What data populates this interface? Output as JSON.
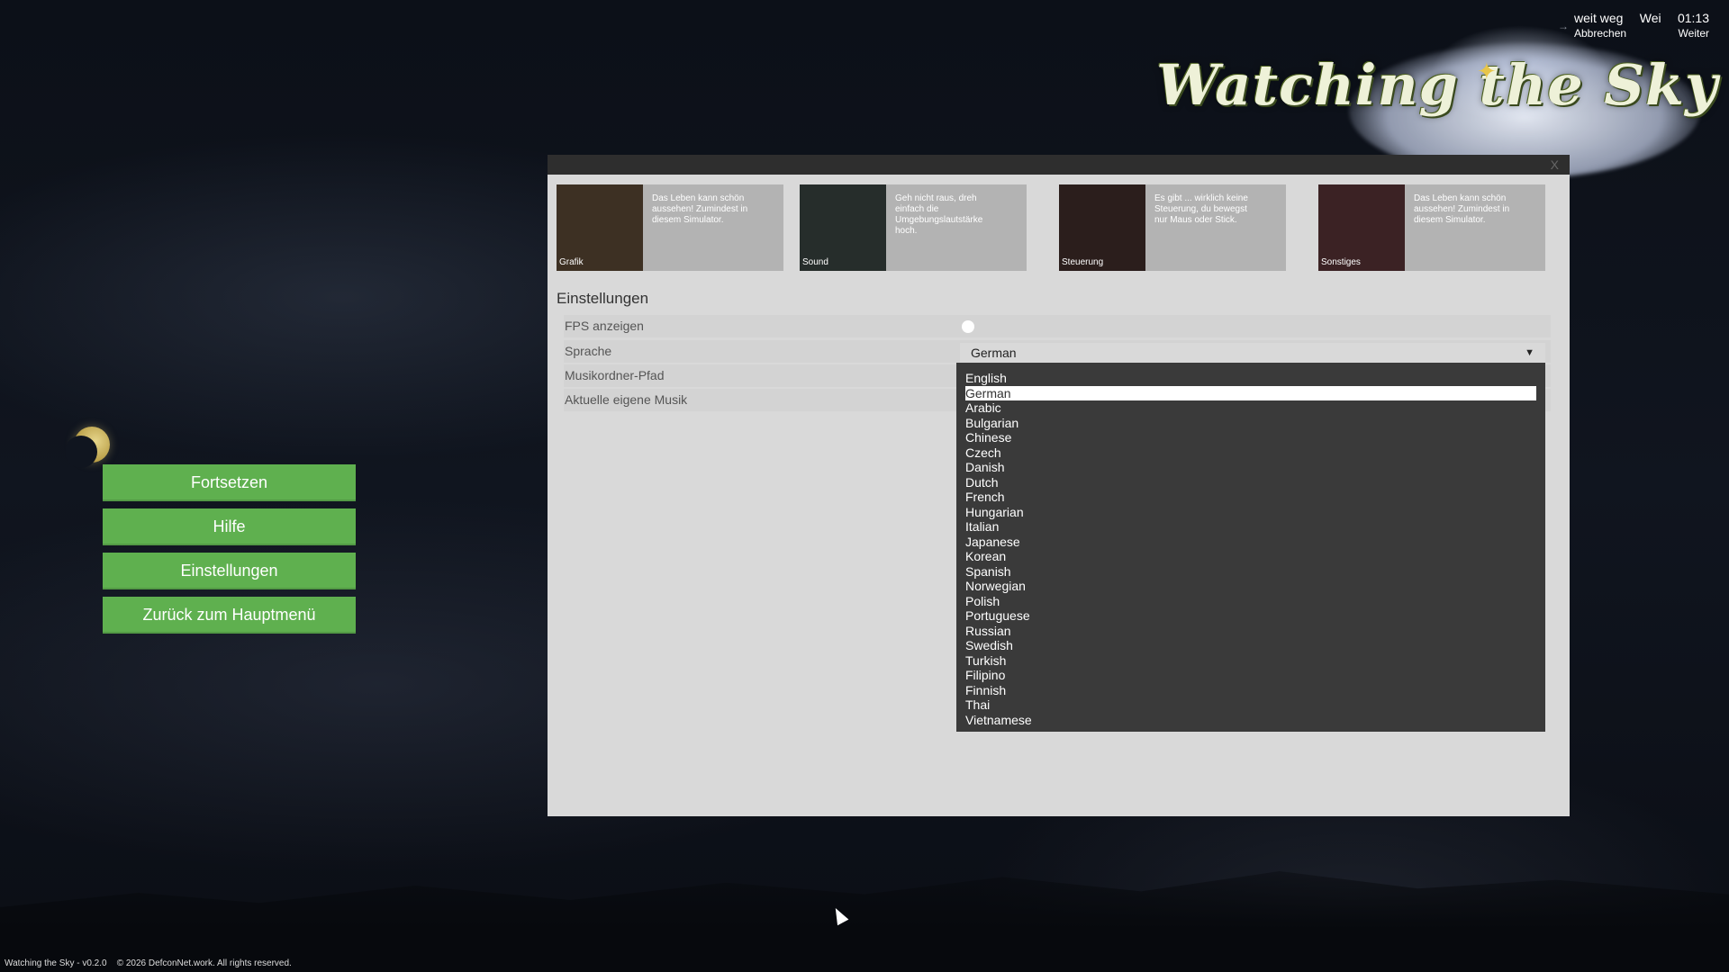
{
  "hud": {
    "distance_label": "weit weg",
    "direction_label": "Wei",
    "time": "01:13",
    "cancel": "Abbrechen",
    "next": "Weiter",
    "arrow_icon": "arrow-icon"
  },
  "logo": {
    "text": "Watching the Sky"
  },
  "menu": {
    "continue": "Fortsetzen",
    "help": "Hilfe",
    "settings": "Einstellungen",
    "main_menu": "Zurück zum Hauptmenü"
  },
  "panel": {
    "close": "X",
    "cards": [
      {
        "label": "Grafik",
        "desc": "Das Leben kann schön aussehen! Zumindest in diesem Simulator.",
        "color": "#3d3023"
      },
      {
        "label": "Sound",
        "desc": "Geh nicht raus, dreh einfach die Umgebungslautstärke hoch.",
        "color": "#262d2b"
      },
      {
        "label": "Steuerung",
        "desc": "Es gibt ... wirklich keine Steuerung, du bewegst nur Maus oder Stick.",
        "color": "#2b1e1c"
      },
      {
        "label": "Sonstiges",
        "desc": "Das Leben kann schön aussehen! Zumindest in diesem Simulator.",
        "color": "#3b2224"
      }
    ],
    "section_title": "Einstellungen",
    "settings": {
      "fps": "FPS anzeigen",
      "language": "Sprache",
      "music_path": "Musikordner-Pfad",
      "current_music": "Aktuelle eigene Musik"
    },
    "fps_enabled": false,
    "language_value": "German",
    "language_options": [
      "English",
      "German",
      "Arabic",
      "Bulgarian",
      "Chinese",
      "Czech",
      "Danish",
      "Dutch",
      "French",
      "Hungarian",
      "Italian",
      "Japanese",
      "Korean",
      "Spanish",
      "Norwegian",
      "Polish",
      "Portuguese",
      "Russian",
      "Swedish",
      "Turkish",
      "Filipino",
      "Finnish",
      "Thai",
      "Vietnamese"
    ],
    "selected_index": 1
  },
  "footer": {
    "version": "Watching the Sky - v0.2.0",
    "copyright": "© 2026 DefconNet.work. All rights reserved."
  }
}
